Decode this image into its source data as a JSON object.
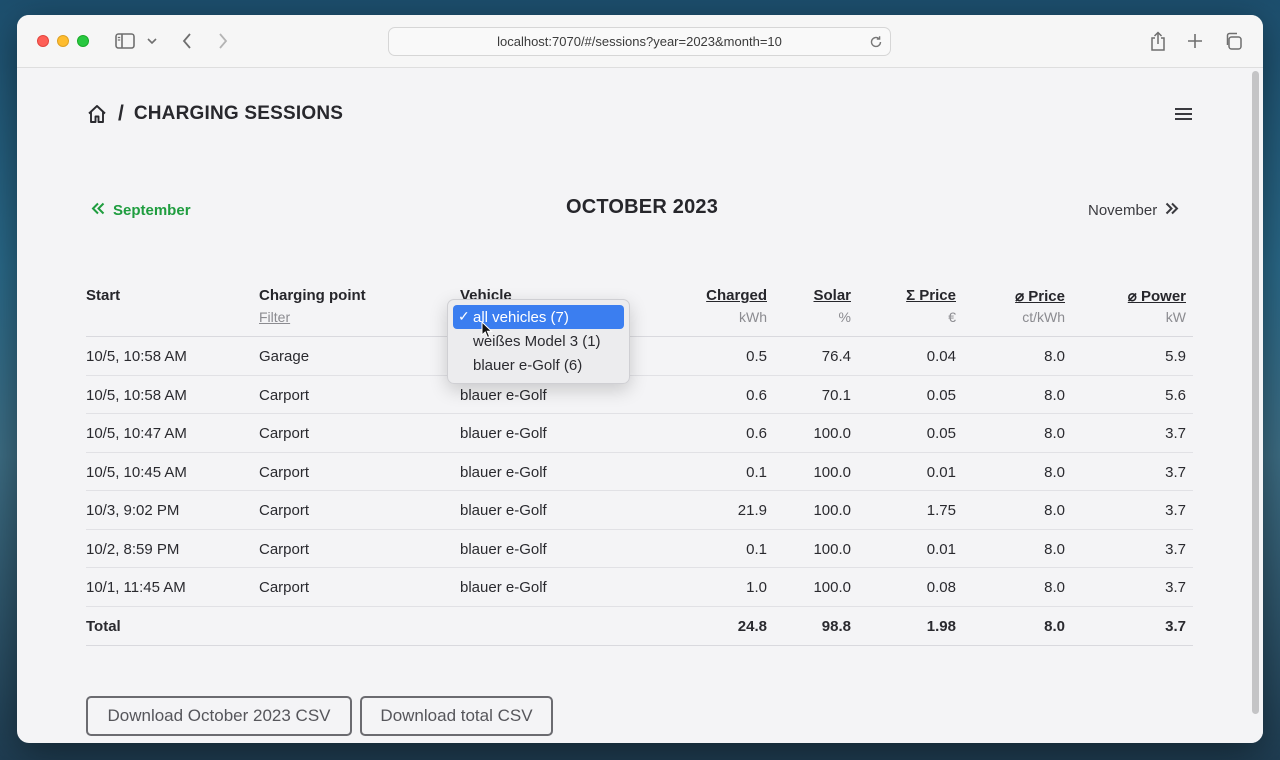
{
  "browser": {
    "url": "localhost:7070/#/sessions?year=2023&month=10"
  },
  "header": {
    "title": "CHARGING SESSIONS",
    "separator": "/"
  },
  "month_nav": {
    "prev_label": "September",
    "current": "OCTOBER 2023",
    "next_label": "November"
  },
  "table": {
    "headers": {
      "start": "Start",
      "charging_point": "Charging point",
      "charging_point_sub": "Filter",
      "vehicle": "Vehicle",
      "charged": "Charged",
      "charged_unit": "kWh",
      "solar": "Solar",
      "solar_unit": "%",
      "price": "Σ Price",
      "price_unit": "€",
      "avg_price": "⌀ Price",
      "avg_price_unit": "ct/kWh",
      "avg_power": "⌀ Power",
      "avg_power_unit": "kW"
    },
    "rows": [
      {
        "start": "10/5, 10:58 AM",
        "point": "Garage",
        "vehicle": "",
        "charged": "0.5",
        "solar": "76.4",
        "price": "0.04",
        "avg_price": "8.0",
        "power": "5.9"
      },
      {
        "start": "10/5, 10:58 AM",
        "point": "Carport",
        "vehicle": "blauer e-Golf",
        "charged": "0.6",
        "solar": "70.1",
        "price": "0.05",
        "avg_price": "8.0",
        "power": "5.6"
      },
      {
        "start": "10/5, 10:47 AM",
        "point": "Carport",
        "vehicle": "blauer e-Golf",
        "charged": "0.6",
        "solar": "100.0",
        "price": "0.05",
        "avg_price": "8.0",
        "power": "3.7"
      },
      {
        "start": "10/5, 10:45 AM",
        "point": "Carport",
        "vehicle": "blauer e-Golf",
        "charged": "0.1",
        "solar": "100.0",
        "price": "0.01",
        "avg_price": "8.0",
        "power": "3.7"
      },
      {
        "start": "10/3, 9:02 PM",
        "point": "Carport",
        "vehicle": "blauer e-Golf",
        "charged": "21.9",
        "solar": "100.0",
        "price": "1.75",
        "avg_price": "8.0",
        "power": "3.7"
      },
      {
        "start": "10/2, 8:59 PM",
        "point": "Carport",
        "vehicle": "blauer e-Golf",
        "charged": "0.1",
        "solar": "100.0",
        "price": "0.01",
        "avg_price": "8.0",
        "power": "3.7"
      },
      {
        "start": "10/1, 11:45 AM",
        "point": "Carport",
        "vehicle": "blauer e-Golf",
        "charged": "1.0",
        "solar": "100.0",
        "price": "0.08",
        "avg_price": "8.0",
        "power": "3.7"
      }
    ],
    "total": {
      "label": "Total",
      "charged": "24.8",
      "solar": "98.8",
      "price": "1.98",
      "avg_price": "8.0",
      "power": "3.7"
    }
  },
  "vehicle_dropdown": {
    "check": "✓",
    "options": [
      {
        "label": "all vehicles (7)",
        "selected": true
      },
      {
        "label": "weißes Model 3 (1)",
        "selected": false
      },
      {
        "label": "blauer e-Golf (6)",
        "selected": false
      }
    ]
  },
  "buttons": {
    "download_month": "Download October 2023 CSV",
    "download_total": "Download total CSV"
  },
  "colors": {
    "accent_green": "#1f9d3f",
    "selection_blue": "#3b7ef0"
  }
}
